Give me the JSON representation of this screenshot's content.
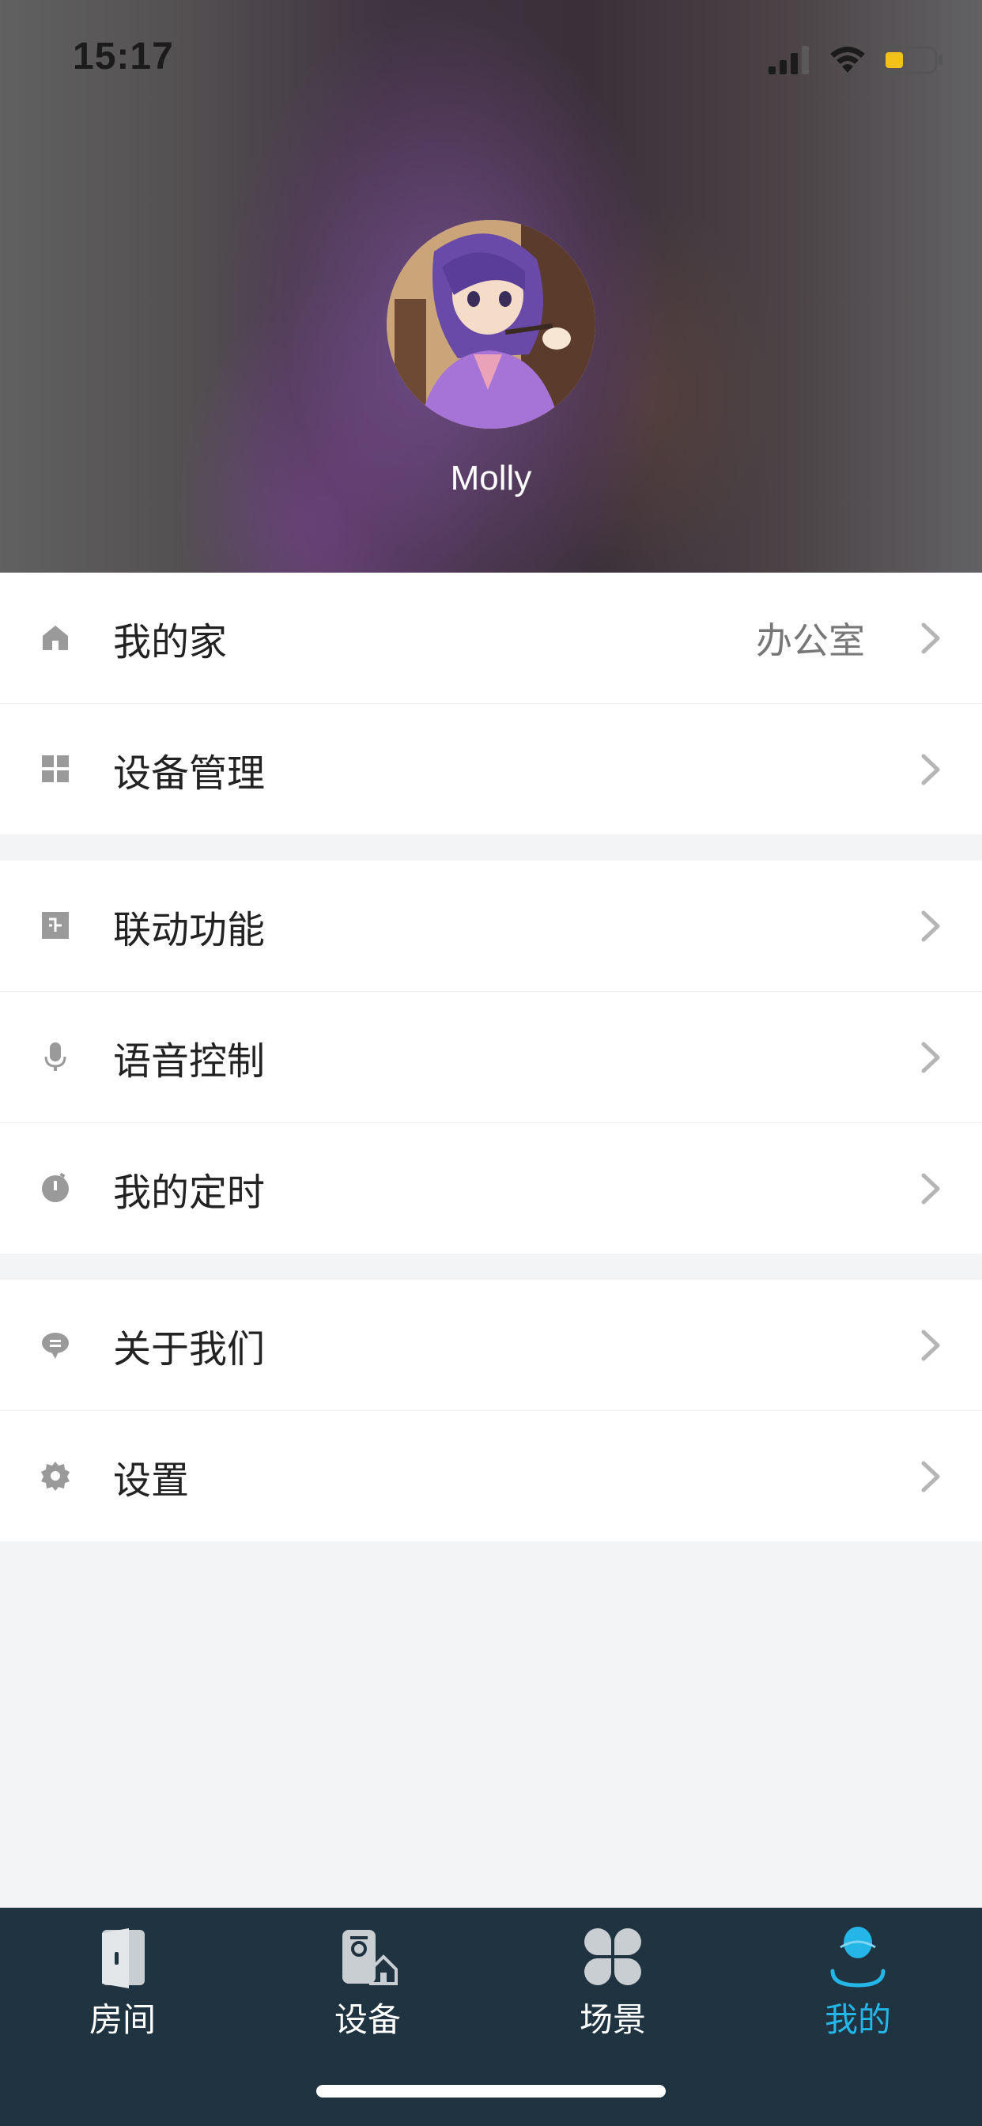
{
  "status_bar": {
    "time": "15:17"
  },
  "profile": {
    "username": "Molly"
  },
  "menu_groups": [
    {
      "items": [
        {
          "label": "我的家",
          "value": "办公室",
          "icon": "home-icon"
        },
        {
          "label": "设备管理",
          "value": "",
          "icon": "grid-icon"
        }
      ]
    },
    {
      "items": [
        {
          "label": "联动功能",
          "value": "",
          "icon": "linkage-icon"
        },
        {
          "label": "语音控制",
          "value": "",
          "icon": "microphone-icon"
        },
        {
          "label": "我的定时",
          "value": "",
          "icon": "timer-icon"
        }
      ]
    },
    {
      "items": [
        {
          "label": "关于我们",
          "value": "",
          "icon": "chat-icon"
        },
        {
          "label": "设置",
          "value": "",
          "icon": "gear-icon"
        }
      ]
    }
  ],
  "tabbar": {
    "tabs": [
      {
        "label": "房间",
        "icon": "door-icon",
        "active": false
      },
      {
        "label": "设备",
        "icon": "device-icon",
        "active": false
      },
      {
        "label": "场景",
        "icon": "clover-icon",
        "active": false
      },
      {
        "label": "我的",
        "icon": "user-icon",
        "active": true
      }
    ]
  },
  "colors": {
    "accent": "#25b6e8",
    "tabbar_bg": "#1f3340",
    "icon_gray": "#999999",
    "page_bg": "#f3f4f6"
  }
}
